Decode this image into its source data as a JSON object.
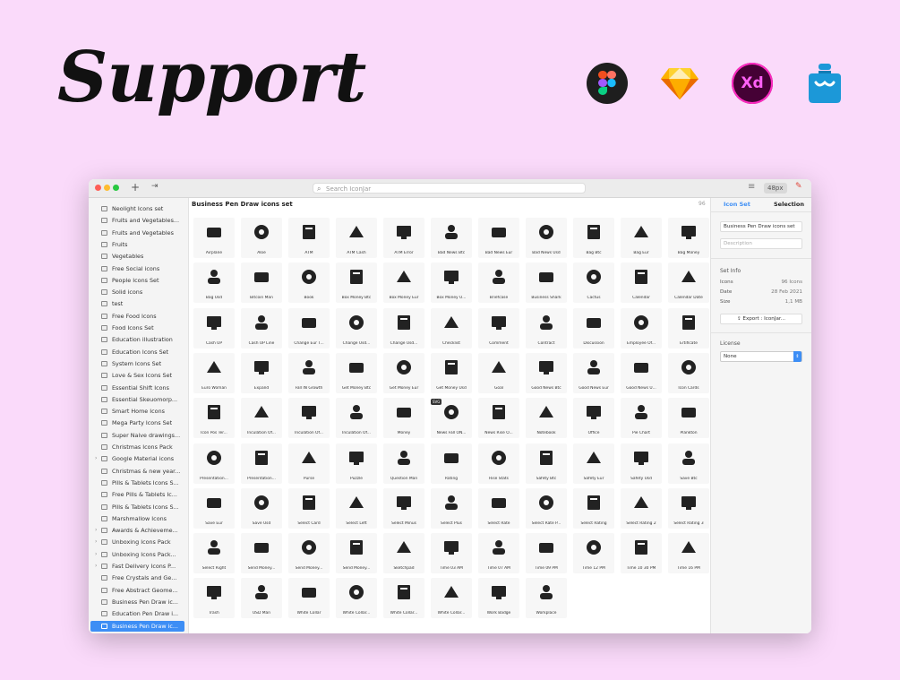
{
  "headline": "Support",
  "app_logos": [
    {
      "name": "figma-logo-icon"
    },
    {
      "name": "sketch-logo-icon"
    },
    {
      "name": "adobe-xd-logo-icon",
      "text": "Xd"
    },
    {
      "name": "iconjar-logo-icon"
    }
  ],
  "toolbar": {
    "add": "+",
    "nav": "⇥",
    "search_placeholder": "Search IconJar",
    "size": "48px"
  },
  "sidebar": {
    "items": [
      {
        "label": "Neolight Icons set"
      },
      {
        "label": "Fruits and Vegetables..."
      },
      {
        "label": "Fruits and Vegetables"
      },
      {
        "label": "Fruits"
      },
      {
        "label": "Vegetables"
      },
      {
        "label": "Free Social icons"
      },
      {
        "label": "People Icons Set"
      },
      {
        "label": "Solid icons"
      },
      {
        "label": "test"
      },
      {
        "label": "Free Food Icons"
      },
      {
        "label": "Food Icons Set"
      },
      {
        "label": "Education illustration"
      },
      {
        "label": "Education Icons Set"
      },
      {
        "label": "System Icons Set"
      },
      {
        "label": "Love & Sex Icons Set"
      },
      {
        "label": "Essential Shift Icons"
      },
      {
        "label": "Essential Skeuomorp..."
      },
      {
        "label": "Smart Home Icons"
      },
      {
        "label": "Mega Party Icons Set"
      },
      {
        "label": "Super Naive drawings..."
      },
      {
        "label": "Christmas Icons Pack"
      },
      {
        "label": "Google Material icons",
        "chevron": true
      },
      {
        "label": "Christmas & new year..."
      },
      {
        "label": "Pills & Tablets Icons S..."
      },
      {
        "label": "Free Pills & Tablets Ic..."
      },
      {
        "label": "Pills & Tablets Icons S..."
      },
      {
        "label": "Marshmallow Icons"
      },
      {
        "label": "Awards & Achieveme...",
        "chevron": true
      },
      {
        "label": "Unboxing Icons Pack",
        "chevron": true
      },
      {
        "label": "Unboxing Icons Pack...",
        "chevron": true
      },
      {
        "label": "Fast Delivery Icons P...",
        "chevron": true
      },
      {
        "label": "Free Crystals and Ge..."
      },
      {
        "label": "Free Abstract Geome..."
      },
      {
        "label": "Business Pen Draw ic..."
      },
      {
        "label": "Education Pen Draw i..."
      },
      {
        "label": "Business Pen Draw ic...",
        "active": true
      }
    ]
  },
  "main": {
    "title": "Business Pen Draw icons set",
    "count": "96",
    "svg_badge": "SVG",
    "icons": [
      "Airplane",
      "Aloe",
      "ATM",
      "ATM Cash",
      "ATM Error",
      "Bad News Btc",
      "Bad News Eur",
      "Bad News Usd",
      "Bag Btc",
      "Bag Eur",
      "Bag Money",
      "Bag Usd",
      "Bitcoin Man",
      "Book",
      "Box Money Btc",
      "Box Money Eur",
      "Box Money U...",
      "Briefcase",
      "Business Shark",
      "Cactus",
      "Calendar",
      "Calendar Date",
      "Cash UP",
      "Cash UP Line",
      "Change Eur T...",
      "Change Usd...",
      "Change Usd...",
      "Checklist",
      "Comment",
      "Contract",
      "Discussion",
      "Employee Of...",
      "Ertificate",
      "Euro Woman",
      "Expand",
      "Fall IN Growth",
      "Get Money Btc",
      "Get Money Eur",
      "Get Money Usd",
      "Goal",
      "Good News Btc",
      "Good News Eur",
      "Good News U...",
      "Icon Cards",
      "Icon Pos Ter...",
      "Inculation Of...",
      "Inculation Of...",
      "Inculation Of...",
      "Money",
      "News Fall ON...",
      "News Rise O...",
      "Notebook",
      "Office",
      "Pie Chart",
      "Plankton",
      "Presentation...",
      "Presentation...",
      "Purse",
      "Puzzle",
      "Question Man",
      "Rating",
      "Rise Stats",
      "Safety Btc",
      "Safety Eur",
      "Safety Usd",
      "Save Btc",
      "Save Eur",
      "Save Usd",
      "Select Card",
      "Select Left",
      "Select Minus",
      "Select Plus",
      "Select Rate",
      "Select Rate P...",
      "Select Rating",
      "Select Rating 2",
      "Select Rating 3",
      "Select Right",
      "Send Money...",
      "Send Money...",
      "Send Money...",
      "Sketchpad",
      "Time 03 AM",
      "Time 07 AM",
      "Time 09 PM",
      "Time 12 PM",
      "Time 10 30 PM",
      "Time 16 PM",
      "Trash",
      "USD Man",
      "White Collar",
      "White Collar...",
      "White Collar...",
      "White Collar...",
      "Work Badge",
      "Workplace"
    ]
  },
  "panel": {
    "tab_icon_set": "Icon Set",
    "tab_selection": "Selection",
    "name_value": "Business Pen Draw icons set",
    "description_placeholder": "Description",
    "set_info_label": "Set Info",
    "rows": [
      {
        "label": "Icons",
        "value": "96 Icons"
      },
      {
        "label": "Date",
        "value": "28 Feb 2021"
      },
      {
        "label": "Size",
        "value": "1,1 MB"
      }
    ],
    "export_label": "Export : IconJar...",
    "license_label": "License",
    "license_value": "None"
  }
}
